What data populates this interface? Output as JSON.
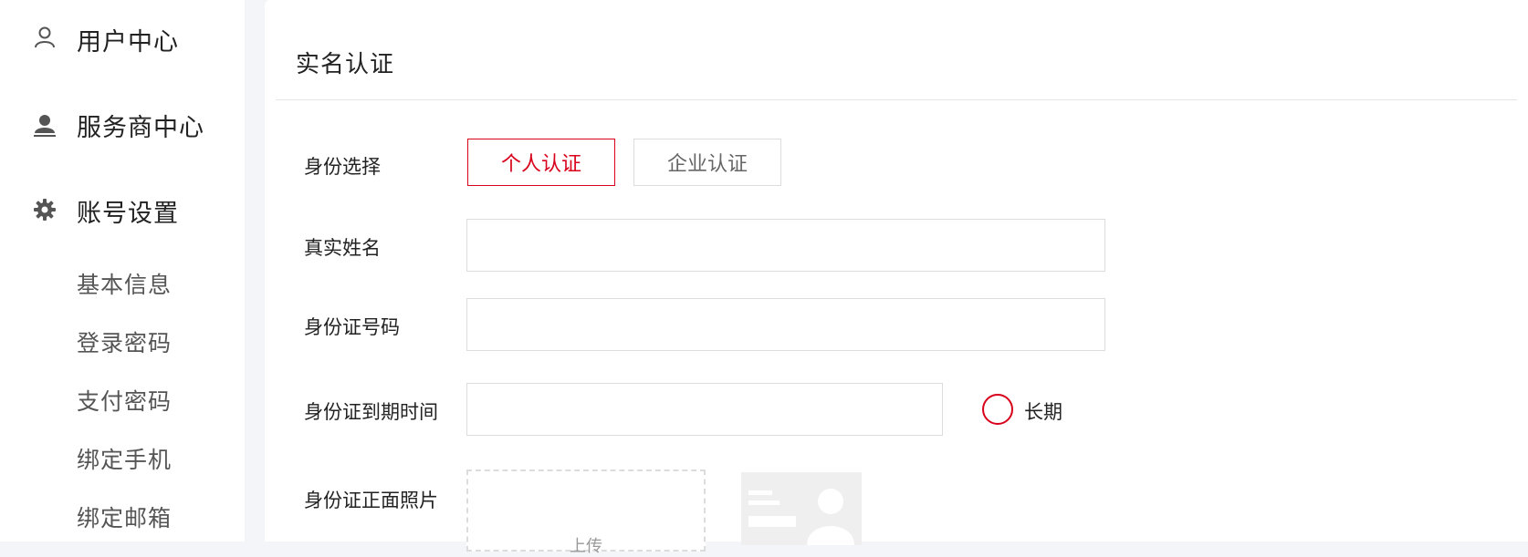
{
  "sidebar": {
    "user_center": {
      "label": "用户中心",
      "icon": "user-icon"
    },
    "provider_center": {
      "label": "服务商中心",
      "icon": "provider-user-icon"
    },
    "account_settings": {
      "label": "账号设置",
      "icon": "gear-icon",
      "items": [
        {
          "label": "基本信息"
        },
        {
          "label": "登录密码"
        },
        {
          "label": "支付密码"
        },
        {
          "label": "绑定手机"
        },
        {
          "label": "绑定邮箱"
        }
      ]
    }
  },
  "main": {
    "title": "实名认证",
    "identity_label": "身份选择",
    "identity_options": [
      {
        "label": "个人认证",
        "selected": true
      },
      {
        "label": "企业认证",
        "selected": false
      }
    ],
    "real_name_label": "真实姓名",
    "real_name_value": "",
    "id_number_label": "身份证号码",
    "id_number_value": "",
    "id_expiry_label": "身份证到期时间",
    "id_expiry_value": "",
    "long_term_label": "长期",
    "front_photo_label": "身份证正面照片",
    "upload_text": "上传"
  },
  "colors": {
    "accent": "#d9001b",
    "border": "#dcdcdc",
    "background": "#f4f5f9"
  }
}
